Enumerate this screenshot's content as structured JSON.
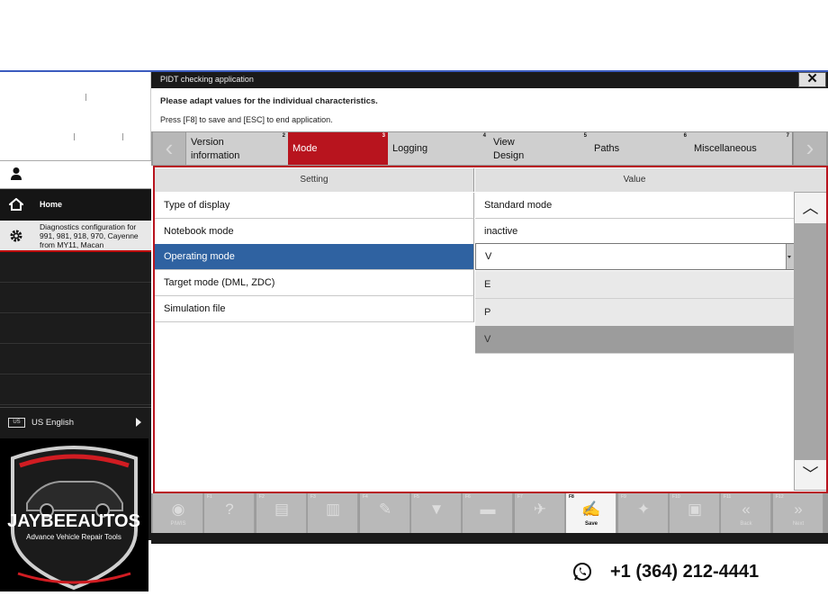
{
  "sidebar": {
    "home_label": "Home",
    "diag_text": "Diagnostics configuration for\n991, 981, 918, 970, Cayenne\nfrom MY11, Macan",
    "language_flag": "US",
    "language_label": "US English"
  },
  "logo": {
    "brand": "JAYBEEAUTOS",
    "tagline": "Advance Vehicle Repair Tools"
  },
  "dialog": {
    "title": "PIDT checking application",
    "close_glyph": "✕",
    "instruction_1": "Please adapt values for the individual characteristics.",
    "instruction_2": "Press [F8] to save and [ESC] to end application."
  },
  "tabs": [
    {
      "label": "Version\ninformation",
      "num": "2"
    },
    {
      "label": "Mode",
      "num": "3"
    },
    {
      "label": "Logging",
      "num": "4"
    },
    {
      "label": "View\nDesign",
      "num": "5"
    },
    {
      "label": "Paths",
      "num": "6"
    },
    {
      "label": "Miscellaneous",
      "num": "7"
    }
  ],
  "table": {
    "header_setting": "Setting",
    "header_value": "Value",
    "rows": [
      {
        "setting": "Type of display",
        "value": "Standard mode"
      },
      {
        "setting": "Notebook mode",
        "value": "inactive"
      },
      {
        "setting": "Operating mode",
        "value": "V"
      },
      {
        "setting": "Target mode (DML, ZDC)",
        "value": ""
      },
      {
        "setting": "Simulation file",
        "value": ""
      }
    ],
    "dropdown_options": [
      "E",
      "P",
      "V"
    ]
  },
  "fkeys": [
    {
      "num": "",
      "icon": "◉",
      "label": "PIWIS",
      "name": "chat-icon"
    },
    {
      "num": "F1",
      "icon": "?",
      "label": "",
      "name": "help-icon"
    },
    {
      "num": "F2",
      "icon": "▤",
      "label": "",
      "name": "screen-icon"
    },
    {
      "num": "F3",
      "icon": "▥",
      "label": "",
      "name": "chart-icon"
    },
    {
      "num": "F4",
      "icon": "✎",
      "label": "",
      "name": "edit-icon"
    },
    {
      "num": "F5",
      "icon": "▼",
      "label": "",
      "name": "filter-icon"
    },
    {
      "num": "F6",
      "icon": "▬",
      "label": "",
      "name": "list-icon"
    },
    {
      "num": "F7",
      "icon": "✈",
      "label": "",
      "name": "tool-icon"
    },
    {
      "num": "F8",
      "icon": "✍",
      "label": "Save",
      "name": "save-icon"
    },
    {
      "num": "F9",
      "icon": "✦",
      "label": "",
      "name": "diag-icon"
    },
    {
      "num": "F10",
      "icon": "▣",
      "label": "",
      "name": "print-icon"
    },
    {
      "num": "F11",
      "icon": "«",
      "label": "Back",
      "name": "back-icon"
    },
    {
      "num": "F12",
      "icon": "»",
      "label": "Next",
      "name": "next-icon"
    }
  ],
  "contact": {
    "phone": "+1 (364) 212-4441"
  }
}
